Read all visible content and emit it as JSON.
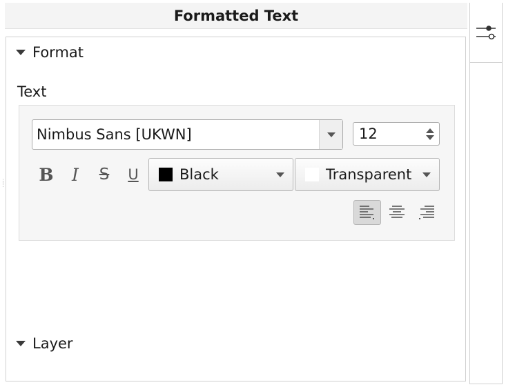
{
  "panel": {
    "title": "Formatted Text"
  },
  "sections": {
    "format": {
      "label": "Format"
    },
    "layer": {
      "label": "Layer"
    }
  },
  "text": {
    "label": "Text",
    "font_name": "Nimbus Sans [UKWN]",
    "font_size": "12",
    "font_color": {
      "label": "Black",
      "swatch": "#000000"
    },
    "background_color": {
      "label": "Transparent",
      "swatch": "#ffffff"
    },
    "style_buttons": {
      "bold": "B",
      "italic": "I",
      "strikethrough": "S",
      "underline": "U"
    }
  },
  "icons": {
    "properties_tab": "sliders-icon",
    "align_left": "align-left-icon",
    "align_center": "align-center-icon",
    "align_right": "align-right-icon"
  }
}
